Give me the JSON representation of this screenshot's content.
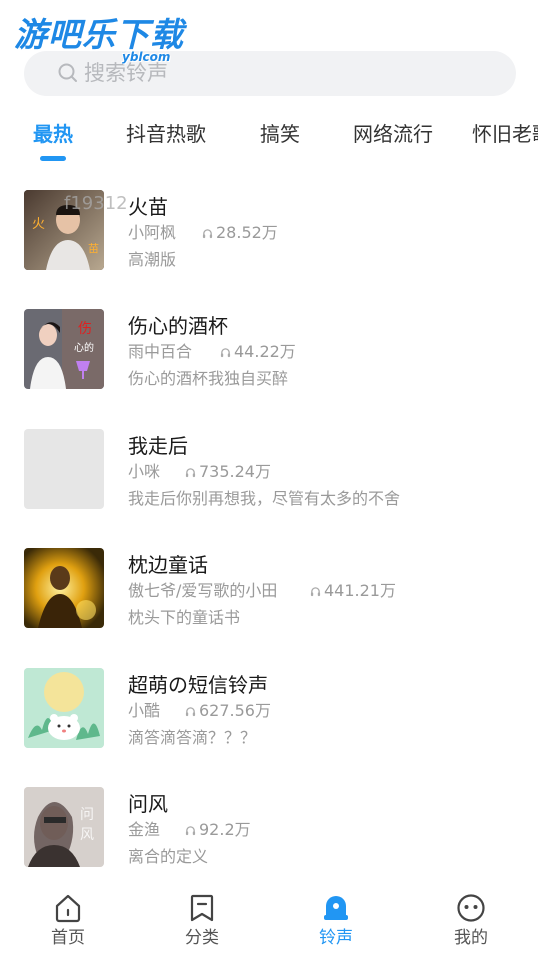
{
  "watermark": {
    "main": "游吧乐下载",
    "sub": "yblcom"
  },
  "search": {
    "placeholder": "搜索铃声"
  },
  "tabs": [
    {
      "label": "最热",
      "active": true
    },
    {
      "label": "抖音热歌",
      "active": false
    },
    {
      "label": "搞笑",
      "active": false
    },
    {
      "label": "网络流行",
      "active": false
    },
    {
      "label": "怀旧老歌",
      "active": false
    }
  ],
  "songs": [
    {
      "title": "火苗",
      "artist": "小阿枫",
      "plays": "28.52万",
      "desc": "高潮版",
      "cover_text": "f19312"
    },
    {
      "title": "伤心的酒杯",
      "artist": "雨中百合",
      "plays": "44.22万",
      "desc": "伤心的酒杯我独自买醉"
    },
    {
      "title": "我走后",
      "artist": "小咪",
      "plays": "735.24万",
      "desc": "我走后你别再想我，尽管有太多的不舍"
    },
    {
      "title": "枕边童话",
      "artist": "傲七爷/爱写歌的小田",
      "plays": "441.21万",
      "desc": "枕头下的童话书"
    },
    {
      "title": "超萌の短信铃声",
      "artist": "小酷",
      "plays": "627.56万",
      "desc": "滴答滴答滴？？？"
    },
    {
      "title": "问风",
      "artist": "金渔",
      "plays": "92.2万",
      "desc": "离合的定义"
    }
  ],
  "nav": [
    {
      "label": "首页",
      "icon": "home-icon",
      "active": false
    },
    {
      "label": "分类",
      "icon": "bookmark-icon",
      "active": false
    },
    {
      "label": "铃声",
      "icon": "bell-icon",
      "active": true
    },
    {
      "label": "我的",
      "icon": "profile-face-icon",
      "active": false
    }
  ],
  "colors": {
    "accent": "#2196f3",
    "secondary_text": "#9a9a9a",
    "search_bg": "#f1f2f4"
  }
}
